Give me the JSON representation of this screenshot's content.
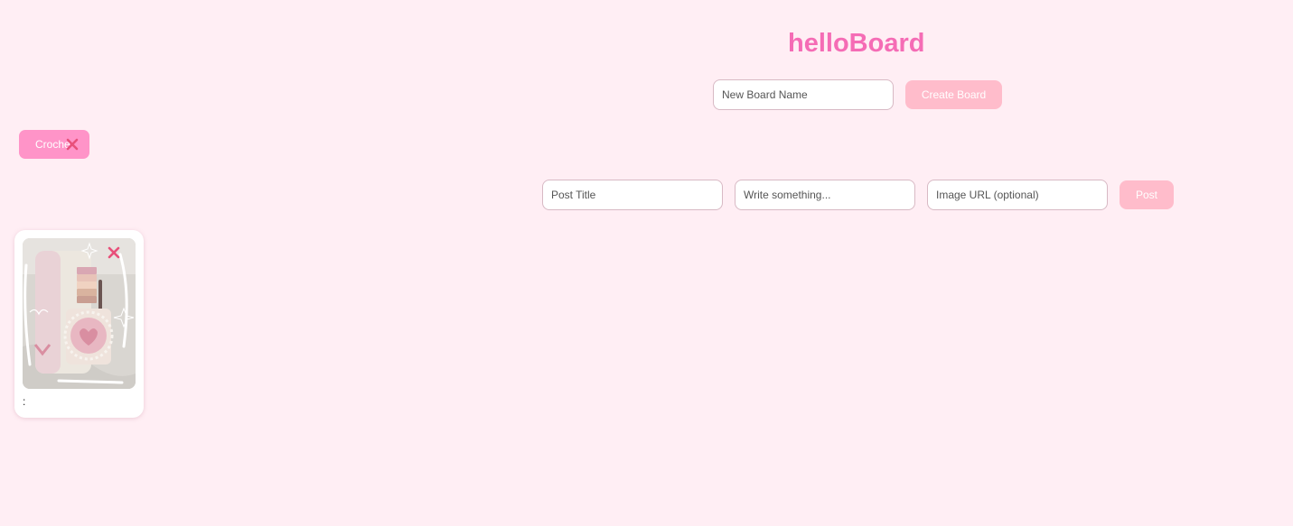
{
  "app": {
    "title": "helloBoard"
  },
  "board_form": {
    "name_placeholder": "New Board Name",
    "create_label": "Create Board"
  },
  "boards": [
    {
      "name": "Croche"
    }
  ],
  "post_form": {
    "title_placeholder": "Post Title",
    "body_placeholder": "Write something...",
    "image_placeholder": "Image URL (optional)",
    "post_label": "Post"
  },
  "posts": [
    {
      "text": ":"
    }
  ],
  "colors": {
    "background": "#ffeef4",
    "title": "#f56cb5",
    "button": "#ffbccb",
    "board_tab": "#ff94c8",
    "delete_icon": "#e8507a"
  },
  "icons": {
    "delete": "close-icon"
  }
}
